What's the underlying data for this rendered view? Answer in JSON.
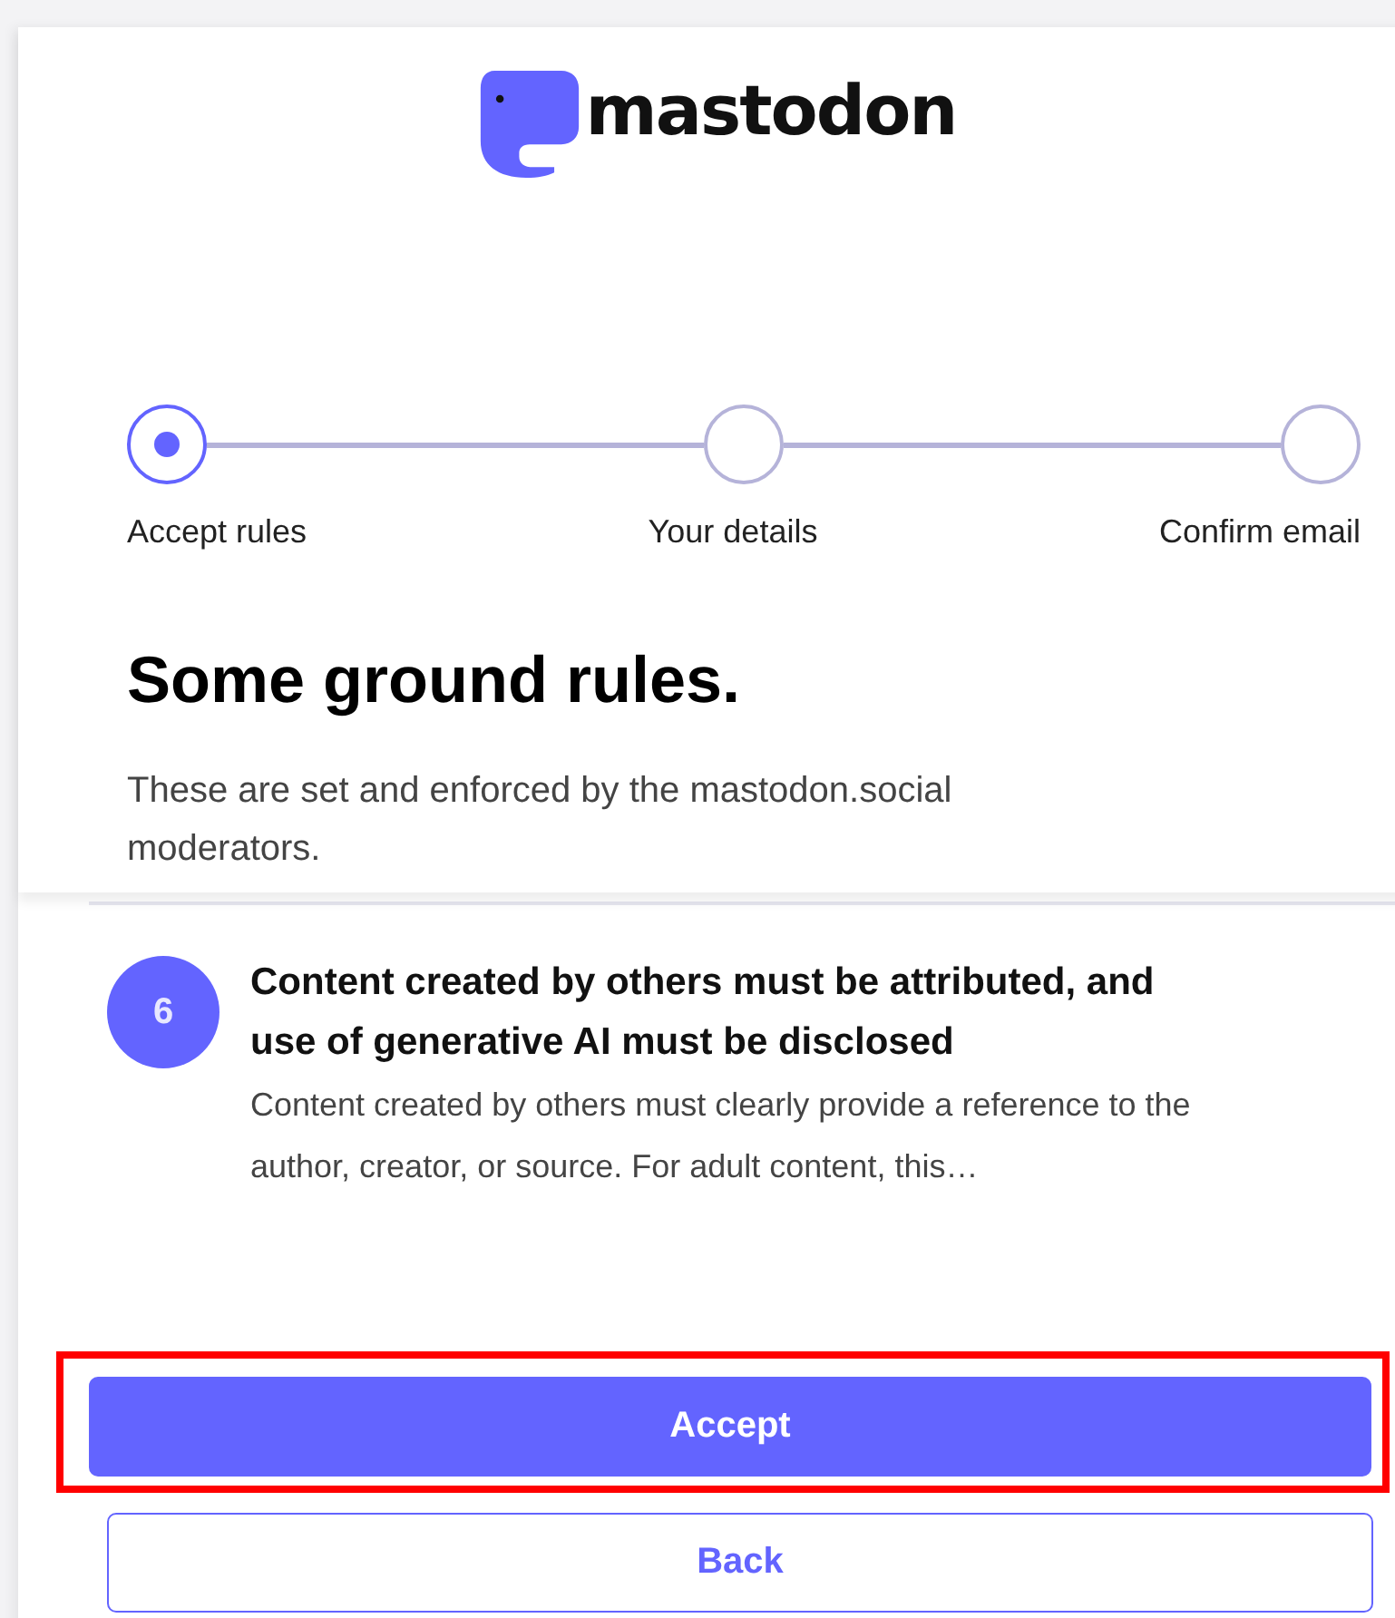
{
  "logo": {
    "wordmark": "mastodon"
  },
  "steps": [
    {
      "label": "Accept rules",
      "selected": true
    },
    {
      "label": "Your details",
      "selected": false
    },
    {
      "label": "Confirm email",
      "selected": false
    }
  ],
  "heading": "Some ground rules.",
  "intro": "These are set and enforced by the mastodon.social moderators.",
  "rules": [
    {
      "number": "6",
      "title": "Content created by others must be attributed, and use of generative AI must be disclosed",
      "description": "Content created by others must clearly provide a reference to the author, creator, or source. For adult content, this…"
    }
  ],
  "buttons": [
    {
      "label": "Accept",
      "kind": "primary",
      "highlighted": true
    },
    {
      "label": "Back",
      "kind": "secondary",
      "highlighted": false
    }
  ]
}
